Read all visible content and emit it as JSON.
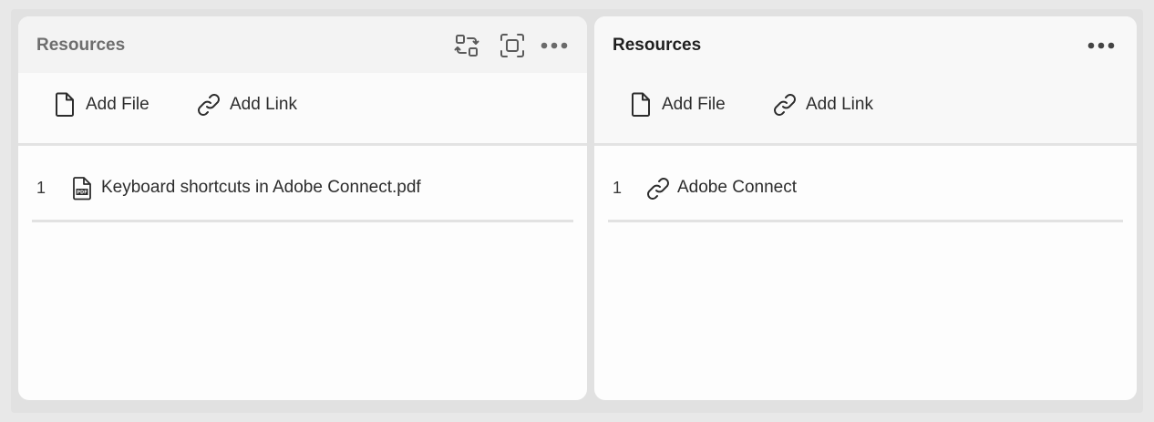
{
  "left_panel": {
    "title": "Resources",
    "header_icons": [
      "swap-icon",
      "fullscreen-icon",
      "more-icon"
    ],
    "toolbar": {
      "add_file_label": "Add File",
      "add_link_label": "Add Link"
    },
    "items": [
      {
        "index": "1",
        "name": "Keyboard shortcuts in Adobe Connect.pdf",
        "icon": "pdf-file-icon"
      }
    ]
  },
  "right_panel": {
    "title": "Resources",
    "header_icons": [
      "more-icon"
    ],
    "toolbar": {
      "add_file_label": "Add File",
      "add_link_label": "Add Link"
    },
    "items": [
      {
        "index": "1",
        "name": "Adobe Connect",
        "icon": "link-icon"
      }
    ]
  },
  "colors": {
    "page_background": "#e8e8e8",
    "panel_background": "#fdfdfd",
    "header_background_inactive": "#f3f3f3",
    "title_inactive": "#6e6e6e",
    "title_active": "#1f1f1f",
    "divider": "#e3e3e3"
  }
}
